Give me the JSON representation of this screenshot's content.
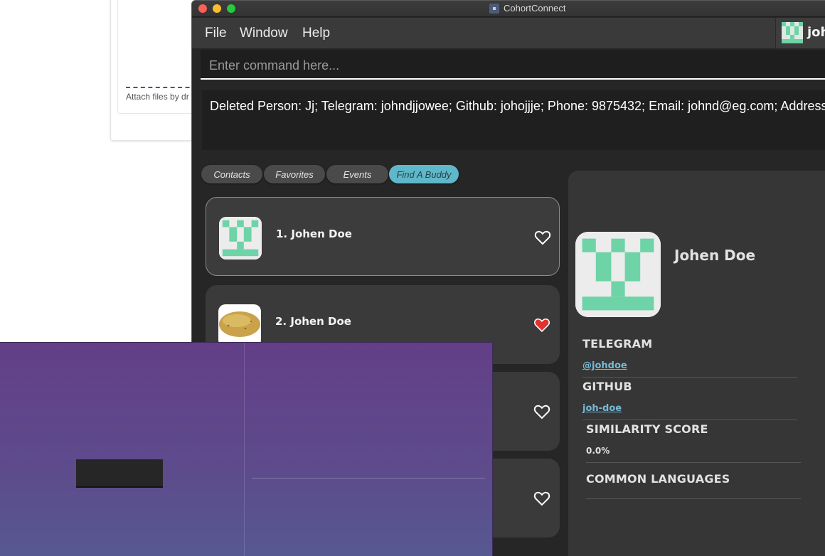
{
  "background": {
    "attach_text": "Attach files by dr"
  },
  "window": {
    "title": "CohortConnect",
    "title_icon": "app-icon"
  },
  "menu": {
    "file": "File",
    "window": "Window",
    "help": "Help",
    "user_name": "john"
  },
  "command": {
    "placeholder": "Enter command here..."
  },
  "result": {
    "text": "Deleted Person: Jj; Telegram: johndjjowee; Github: johojjje; Phone: 9875432; Email: johnd@eg.com; Address: 新加"
  },
  "tabs": [
    {
      "label": "Contacts",
      "active": false
    },
    {
      "label": "Favorites",
      "active": false
    },
    {
      "label": "Events",
      "active": false
    },
    {
      "label": "Find A Buddy",
      "active": true
    }
  ],
  "persons": [
    {
      "label": "1.  Johen Doe",
      "avatar": "identicon",
      "favorite": false
    },
    {
      "label": "2.  Johen Doe",
      "avatar": "potato",
      "favorite": true
    },
    {
      "label": "",
      "avatar": "",
      "favorite": false
    },
    {
      "label": "",
      "avatar": "",
      "favorite": false
    }
  ],
  "detail": {
    "name": "Johen Doe",
    "telegram_label": "TELEGRAM",
    "telegram_value": "@johdoe",
    "github_label": "GITHUB",
    "github_value": "joh-doe",
    "similarity_label": "SIMILARITY SCORE",
    "similarity_value": "0.0%",
    "languages_label": "COMMON LANGUAGES"
  },
  "colors": {
    "accent_tab": "#5fb8c9",
    "identicon": "#6ed3a6",
    "heart_filled": "#e2322f",
    "link": "#76b9d6"
  }
}
